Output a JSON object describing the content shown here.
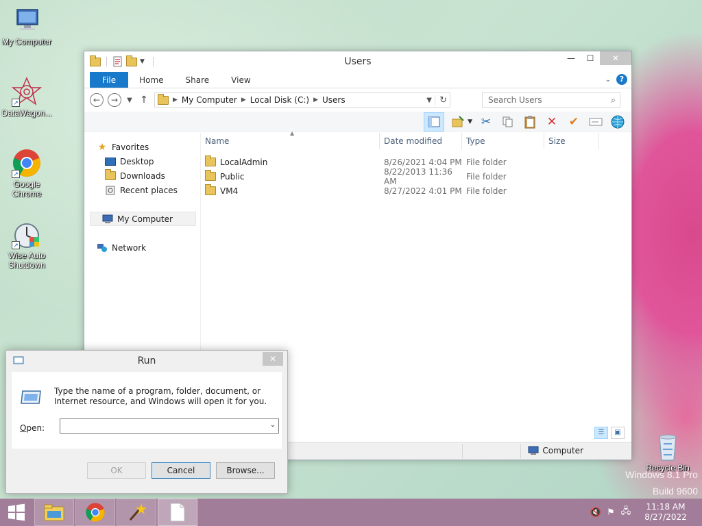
{
  "desktop": {
    "icons": [
      {
        "label": "My Computer"
      },
      {
        "label": "DataWagon..."
      },
      {
        "label": "Google Chrome"
      },
      {
        "label": "Wise Auto Shutdown"
      },
      {
        "label": "Recycle Bin"
      }
    ],
    "watermark": {
      "line1": "Windows 8.1 Pro",
      "line2": "Build 9600"
    }
  },
  "explorer": {
    "title": "Users",
    "ribbon_tabs": [
      "File",
      "Home",
      "Share",
      "View"
    ],
    "address": [
      "My Computer",
      "Local Disk (C:)",
      "Users"
    ],
    "search_placeholder": "Search Users",
    "nav": {
      "favorites": "Favorites",
      "favorites_items": [
        "Desktop",
        "Downloads",
        "Recent places"
      ],
      "my_computer": "My Computer",
      "network": "Network"
    },
    "columns": [
      "Name",
      "Date modified",
      "Type",
      "Size"
    ],
    "files": [
      {
        "name": "LocalAdmin",
        "date": "8/26/2021 4:04 PM",
        "type": "File folder"
      },
      {
        "name": "Public",
        "date": "8/22/2013 11:36 AM",
        "type": "File folder"
      },
      {
        "name": "VM4",
        "date": "8/27/2022 4:01 PM",
        "type": "File folder"
      }
    ],
    "status_location": "Computer"
  },
  "run": {
    "title": "Run",
    "description": "Type the name of a program, folder, document, or Internet resource, and Windows will open it for you.",
    "open_label_prefix": "",
    "open_label_access": "O",
    "open_label_rest": "pen:",
    "open_value": "",
    "ok": "OK",
    "cancel": "Cancel",
    "browse": "Browse..."
  },
  "taskbar": {
    "time": "11:18 AM",
    "date": "8/27/2022"
  },
  "colors": {
    "accent": "#1979ca",
    "taskbar": "#a17d99"
  }
}
